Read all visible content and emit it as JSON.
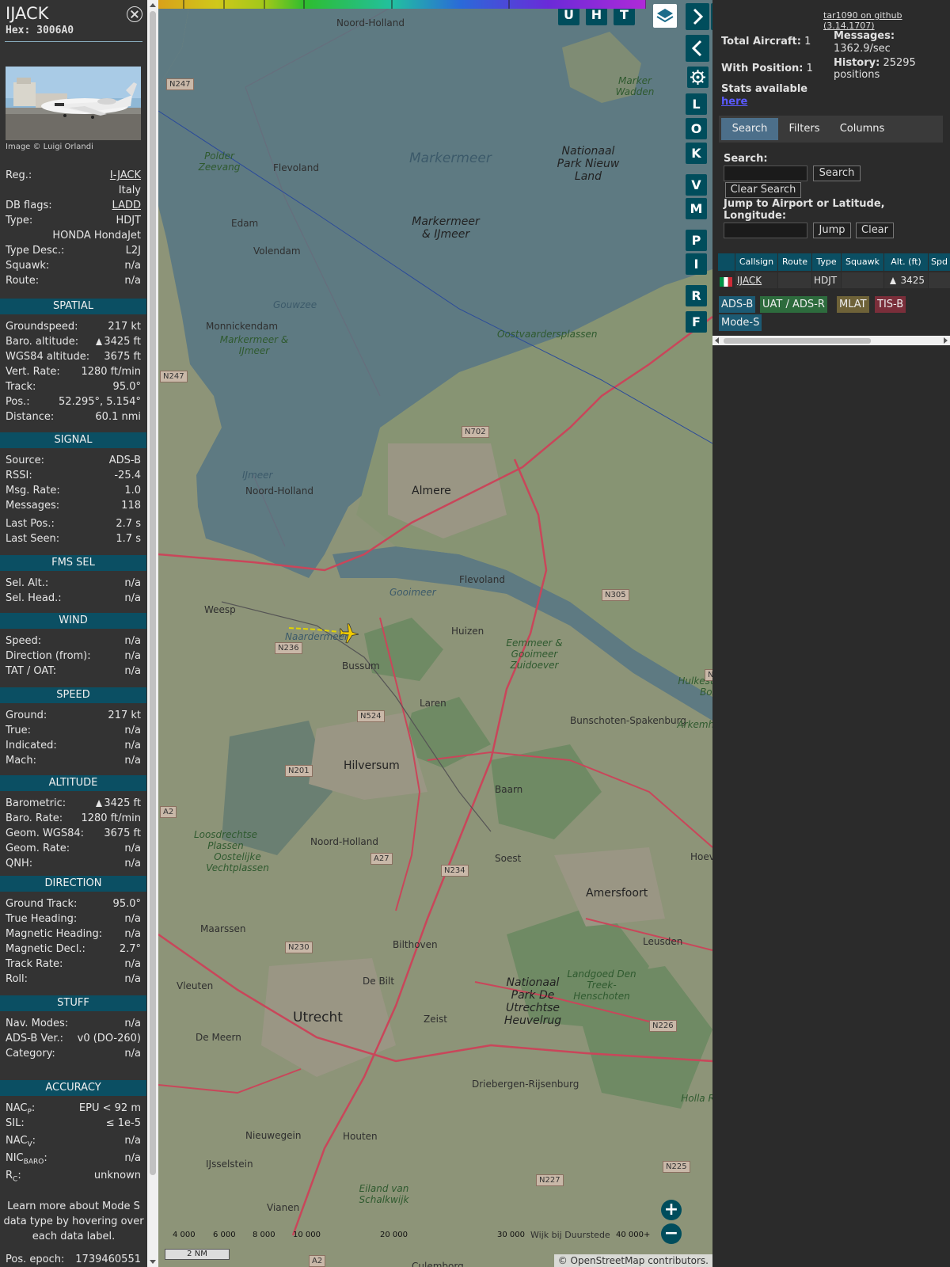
{
  "aircraft": {
    "title": "IJACK",
    "hex_label": "Hex:",
    "hex": "3006A0",
    "photo_credit": "Image © Luigi Orlandi",
    "general": [
      {
        "label": "Reg.:",
        "value": "I-JACK",
        "link": true
      },
      {
        "label": "",
        "value": "Italy"
      },
      {
        "label": "DB flags:",
        "value": "LADD",
        "link": true
      },
      {
        "label": "Type:",
        "value": "HDJT"
      },
      {
        "label": "",
        "value": "HONDA HondaJet"
      },
      {
        "label": "Type Desc.:",
        "value": "L2J"
      },
      {
        "label": "Squawk:",
        "value": "n/a"
      },
      {
        "label": "Route:",
        "value": "n/a"
      }
    ]
  },
  "sections": {
    "spatial": {
      "title": "SPATIAL",
      "rows": [
        {
          "label": "Groundspeed:",
          "value": "217 kt"
        },
        {
          "label": "Baro. altitude:",
          "value": "3425 ft",
          "tri": true
        },
        {
          "label": "WGS84 altitude:",
          "value": "3675 ft"
        },
        {
          "label": "Vert. Rate:",
          "value": "1280 ft/min"
        },
        {
          "label": "Track:",
          "value": "95.0°"
        },
        {
          "label": "Pos.:",
          "value": "52.295°, 5.154°"
        },
        {
          "label": "Distance:",
          "value": "60.1 nmi"
        }
      ]
    },
    "signal": {
      "title": "SIGNAL",
      "rows": [
        {
          "label": "Source:",
          "value": "ADS-B"
        },
        {
          "label": "RSSI:",
          "value": "-25.4"
        },
        {
          "label": "Msg. Rate:",
          "value": "1.0"
        },
        {
          "label": "Messages:",
          "value": "118"
        },
        {
          "label": "Last Pos.:",
          "value": "2.7 s"
        },
        {
          "label": "Last Seen:",
          "value": "1.7 s"
        }
      ]
    },
    "fms": {
      "title": "FMS SEL",
      "rows": [
        {
          "label": "Sel. Alt.:",
          "value": "n/a"
        },
        {
          "label": "Sel. Head.:",
          "value": "n/a"
        }
      ]
    },
    "wind": {
      "title": "WIND",
      "rows": [
        {
          "label": "Speed:",
          "value": "n/a"
        },
        {
          "label": "Direction (from):",
          "value": "n/a"
        },
        {
          "label": "TAT / OAT:",
          "value": "n/a"
        }
      ]
    },
    "speed": {
      "title": "SPEED",
      "rows": [
        {
          "label": "Ground:",
          "value": "217 kt"
        },
        {
          "label": "True:",
          "value": "n/a"
        },
        {
          "label": "Indicated:",
          "value": "n/a"
        },
        {
          "label": "Mach:",
          "value": "n/a"
        }
      ]
    },
    "altitude": {
      "title": "ALTITUDE",
      "rows": [
        {
          "label": "Barometric:",
          "value": "3425 ft",
          "tri": true
        },
        {
          "label": "Baro. Rate:",
          "value": "1280 ft/min"
        },
        {
          "label": "Geom. WGS84:",
          "value": "3675 ft"
        },
        {
          "label": "Geom. Rate:",
          "value": "n/a"
        },
        {
          "label": "QNH:",
          "value": "n/a"
        }
      ]
    },
    "direction": {
      "title": "DIRECTION",
      "rows": [
        {
          "label": "Ground Track:",
          "value": "95.0°"
        },
        {
          "label": "True Heading:",
          "value": "n/a"
        },
        {
          "label": "Magnetic Heading:",
          "value": "n/a"
        },
        {
          "label": "Magnetic Decl.:",
          "value": "2.7°"
        },
        {
          "label": "Track Rate:",
          "value": "n/a"
        },
        {
          "label": "Roll:",
          "value": "n/a"
        }
      ]
    },
    "stuff": {
      "title": "STUFF",
      "rows": [
        {
          "label": "Nav. Modes:",
          "value": "n/a"
        },
        {
          "label": "ADS-B Ver.:",
          "value": "v0 (DO-260)"
        },
        {
          "label": "Category:",
          "value": "n/a"
        }
      ]
    },
    "accuracy": {
      "title": "ACCURACY",
      "rows": [
        {
          "label": "NAC",
          "sub": "P",
          "value": "EPU < 92 m"
        },
        {
          "label": "SIL:",
          "value": "≤ 1e-5"
        },
        {
          "label": "NAC",
          "sub": "V",
          "value": "n/a"
        },
        {
          "label": "NIC",
          "sub": "BARO",
          "value": "n/a"
        },
        {
          "label": "R",
          "sub": "C",
          "value": "unknown"
        }
      ]
    }
  },
  "learn_more": "Learn more about Mode S data type by hovering over each data label.",
  "pos_epoch": {
    "label": "Pos. epoch:",
    "value": "1739460551"
  },
  "map": {
    "labels": [
      "Markermeer",
      "Markermeer & IJmeer",
      "Nationaal Park Nieuw Land",
      "Marker Wadden",
      "Noord-Holland",
      "Flevoland",
      "Polder Zeevang",
      "Edam",
      "Volendam",
      "Monnickendam",
      "Markermeer & IJmeer",
      "Gouwzee",
      "Oostvaardersplassen",
      "Almere",
      "IJmeer",
      "Noord-Holland",
      "Flevoland",
      "Gooimeer",
      "Weesp",
      "Naardermeer",
      "Huizen",
      "Bussum",
      "Eemmeer & Gooimeer Zuidoever",
      "Laren",
      "Hulkesteinse Bos",
      "Bunschoten-Spakenburg",
      "Arkemheen",
      "Hilversum",
      "Baarn",
      "Loosdrechtse Plassen",
      "Oostelijke Vechtplassen",
      "Noord-Holland",
      "Soest",
      "Amersfoort",
      "Hoevela",
      "Maarssen",
      "Bilthoven",
      "Leusden",
      "De Bilt",
      "Vleuten",
      "Utrecht",
      "Zeist",
      "Nationaal Park De Utrechtse Heuvelrug",
      "Landgoed Den Treek-Henschoten",
      "De Meern",
      "Driebergen-Rijsenburg",
      "Nieuwegein",
      "IJsselstein",
      "Houten",
      "Eiland van Schalkwijk",
      "Vianen",
      "Wijk bij Duurstede",
      "Culemborg",
      "Holla Rui"
    ],
    "roads": [
      "N247",
      "N247",
      "N702",
      "N305",
      "N236",
      "N524",
      "N201",
      "N234",
      "A27",
      "N230",
      "N226",
      "A2",
      "N227",
      "N225",
      "A2",
      "N"
    ],
    "layer_buttons": [
      "U",
      "H",
      "T"
    ],
    "side_buttons": [
      "L",
      "O",
      "K",
      "V",
      "M",
      "P",
      "I",
      "R",
      "F"
    ],
    "altitude_scale": [
      "4 000",
      "6 000",
      "8 000",
      "10 000",
      "20 000",
      "30 000",
      "40 000+"
    ],
    "scale_bar": "2 NM",
    "attribution": "© OpenStreetMap contributors.",
    "zoom_in": "+",
    "zoom_out": "−",
    "aircraft_track_deg": 95.0
  },
  "right_panel": {
    "github": "tar1090 on github (3.14.1707)",
    "total_aircraft_label": "Total Aircraft:",
    "total_aircraft": "1",
    "with_position_label": "With Position:",
    "with_position": "1",
    "messages_label": "Messages:",
    "messages_rate": "1362.9/sec",
    "history_label": "History:",
    "history": "25295",
    "history_unit": "positions",
    "stats_label": "Stats available",
    "stats_link": "here",
    "tabs": [
      "Search",
      "Filters",
      "Columns"
    ],
    "search_label": "Search:",
    "search_button": "Search",
    "clear_search_button": "Clear Search",
    "jump_label": "Jump to Airport or Latitude, Longitude:",
    "jump_button": "Jump",
    "clear_button": "Clear",
    "table_headers": [
      "Callsign",
      "Route",
      "Type",
      "Squawk",
      "Alt. (ft)",
      "Spd"
    ],
    "table_row": {
      "callsign": "IJACK",
      "route": "",
      "type": "HDJT",
      "squawk": "",
      "alt": "3425"
    },
    "sources": [
      "ADS-B",
      "UAT / ADS-R",
      "MLAT",
      "TIS-B",
      "Mode-S"
    ],
    "source_colors": {
      "ADS-B": "#1c5a73",
      "UAT / ADS-R": "#2d6b3d",
      "MLAT": "#6e6238",
      "TIS-B": "#7a2e3a",
      "Mode-S": "#1c5a73"
    }
  }
}
